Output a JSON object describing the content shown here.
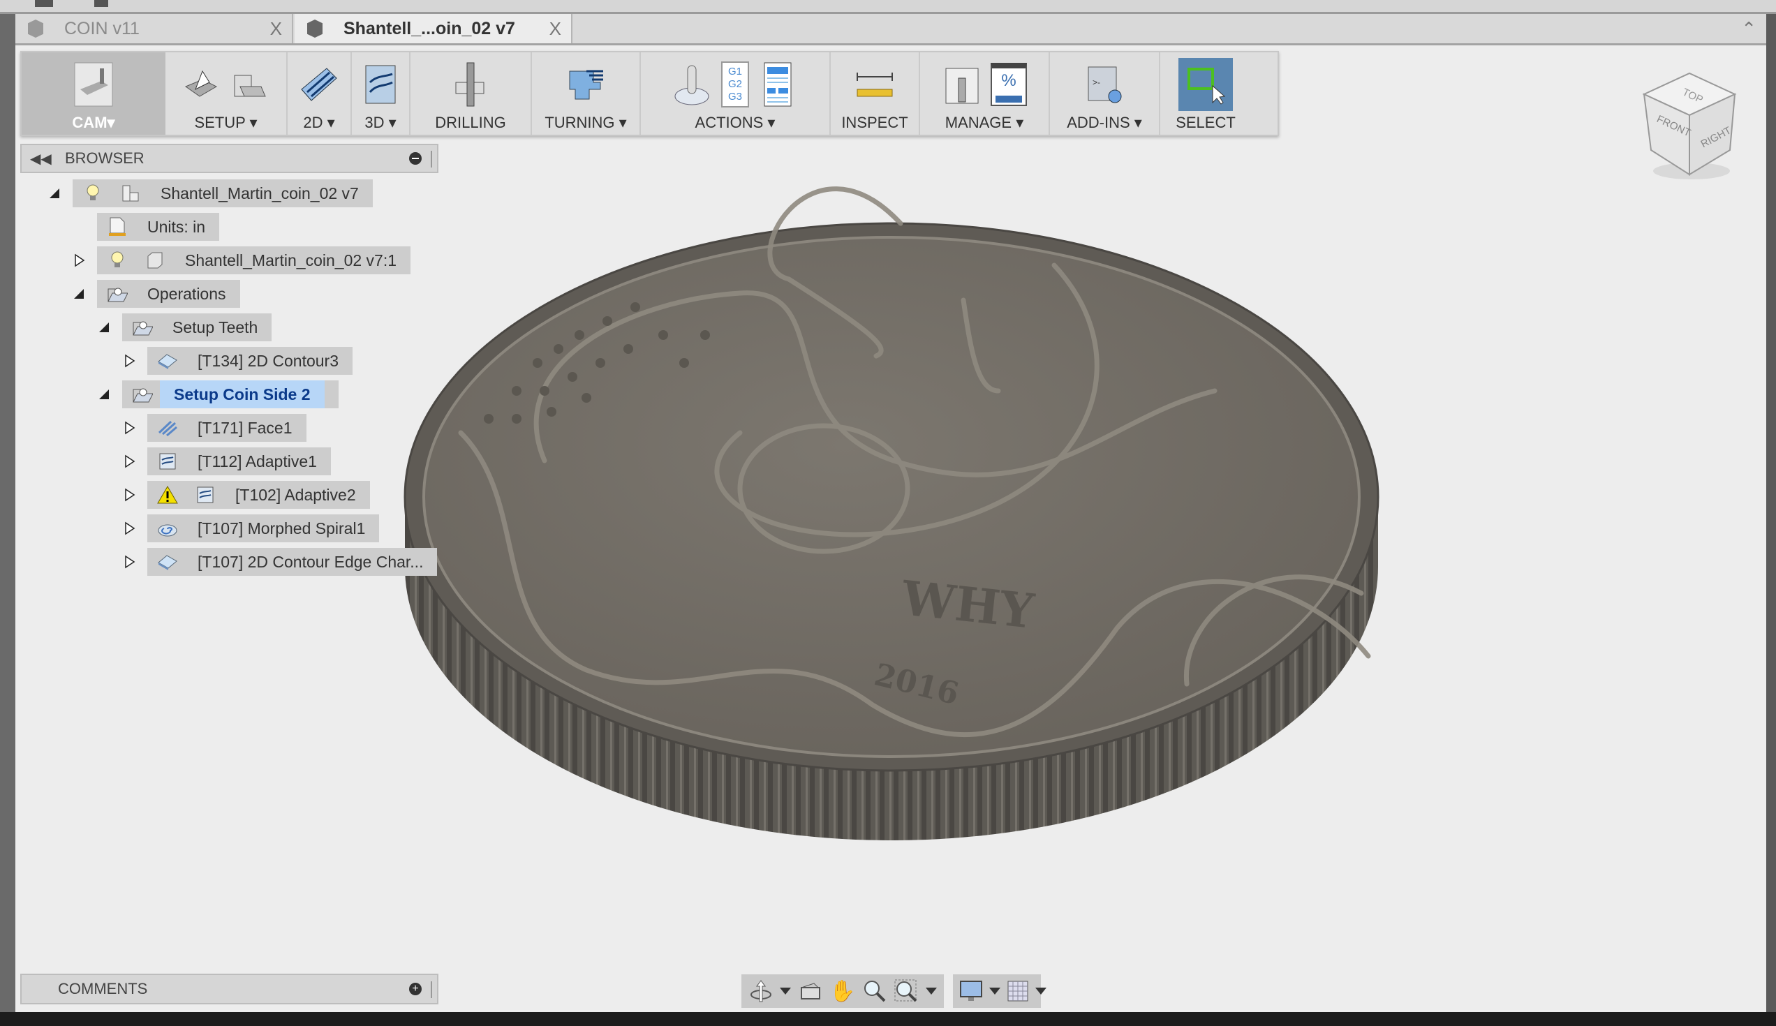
{
  "tabs": [
    {
      "label": "COIN v11",
      "close": "X",
      "active": false
    },
    {
      "label": "Shantell_...oin_02 v7",
      "close": "X",
      "active": true
    }
  ],
  "toolbar": {
    "groups": [
      {
        "label": "CAM▾",
        "icon": "cam-workspace-icon"
      },
      {
        "label": "SETUP ▾",
        "icon": "setup-icon"
      },
      {
        "label": "2D ▾",
        "icon": "2d-milling-icon"
      },
      {
        "label": "3D ▾",
        "icon": "3d-milling-icon"
      },
      {
        "label": "DRILLING",
        "icon": "drill-icon"
      },
      {
        "label": "TURNING ▾",
        "icon": "turning-icon"
      },
      {
        "label": "ACTIONS ▾",
        "icon": "simulate-icon"
      },
      {
        "label": "INSPECT",
        "icon": "measure-icon"
      },
      {
        "label": "MANAGE ▾",
        "icon": "tool-library-icon"
      },
      {
        "label": "ADD-INS ▾",
        "icon": "scripts-icon"
      },
      {
        "label": "SELECT",
        "icon": "select-icon"
      }
    ],
    "gcode_lines": [
      "G1",
      "G2",
      "G3"
    ],
    "percent_symbol": "%"
  },
  "browser": {
    "title": "BROWSER",
    "items": [
      {
        "label": "Shantell_Martin_coin_02 v7",
        "level": 0,
        "expanded": true,
        "icon": "component-icon",
        "visibility": true
      },
      {
        "label": "Units: in",
        "level": 1,
        "icon": "units-document-icon"
      },
      {
        "label": "Shantell_Martin_coin_02 v7:1",
        "level": 1,
        "expanded": false,
        "icon": "body-icon",
        "visibility": true
      },
      {
        "label": "Operations",
        "level": 1,
        "expanded": true,
        "icon": "setup-folder-icon"
      },
      {
        "label": "Setup Teeth",
        "level": 2,
        "expanded": true,
        "icon": "setup-folder-icon"
      },
      {
        "label": "[T134] 2D Contour3",
        "level": 3,
        "expanded": false,
        "icon": "contour-icon"
      },
      {
        "label": "Setup Coin Side 2",
        "level": 2,
        "expanded": true,
        "icon": "setup-folder-icon",
        "selected": true
      },
      {
        "label": "[T171] Face1",
        "level": 3,
        "expanded": false,
        "icon": "face-icon"
      },
      {
        "label": "[T112] Adaptive1",
        "level": 3,
        "expanded": false,
        "icon": "adaptive-icon"
      },
      {
        "label": "[T102] Adaptive2",
        "level": 3,
        "expanded": false,
        "icon": "adaptive-icon",
        "warning": true
      },
      {
        "label": "[T107] Morphed Spiral1",
        "level": 3,
        "expanded": false,
        "icon": "spiral-icon"
      },
      {
        "label": "[T107] 2D Contour Edge Char...",
        "level": 3,
        "expanded": false,
        "icon": "contour-icon"
      }
    ]
  },
  "comments": {
    "title": "COMMENTS"
  },
  "viewcube": {
    "top": "TOP",
    "front": "FRONT",
    "right": "RIGHT"
  },
  "model": {
    "engraving_word": "WHY",
    "engraving_year": "2016"
  },
  "colors": {
    "accent": "#5a86b0",
    "selection": "#b7d6f7",
    "selection_text": "#0b3a8a",
    "coin": "#77726a",
    "warning": "#f4e000"
  }
}
